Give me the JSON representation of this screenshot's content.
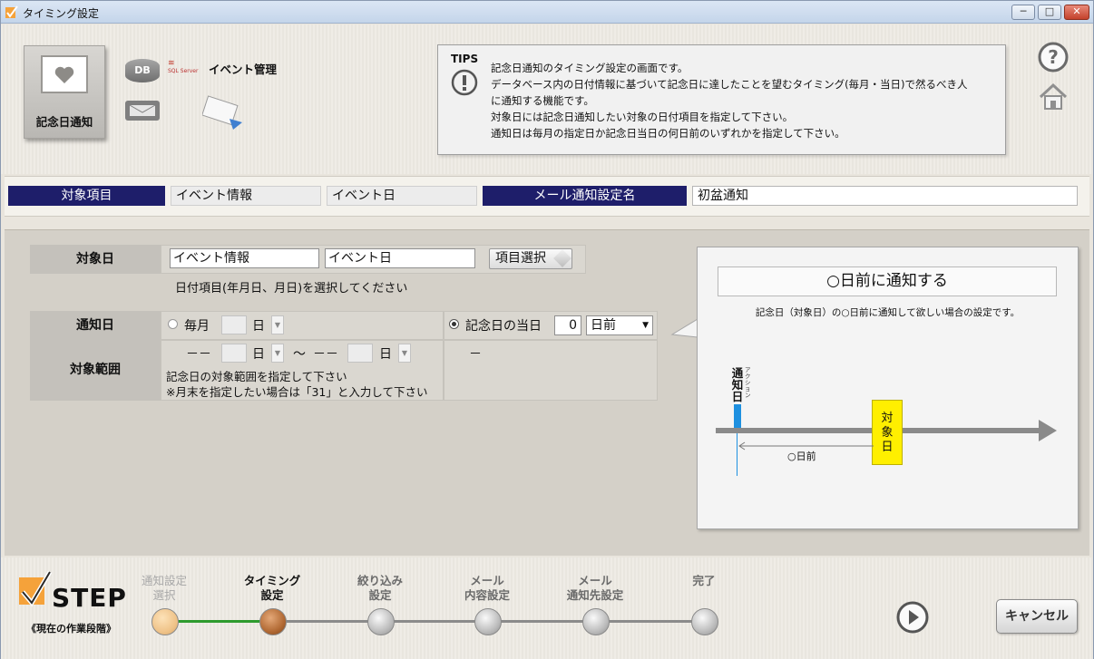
{
  "window": {
    "title": "タイミング設定",
    "minimize": "─",
    "maximize": "□",
    "close": "✕"
  },
  "header": {
    "feature_label": "記念日通知",
    "db_label": "DB",
    "sqlserver_label": "SQL Server",
    "event_mgmt_label": "イベント管理",
    "tips_title": "TIPS",
    "tips_lines": [
      "記念日通知のタイミング設定の画面です。",
      "データベース内の日付情報に基づいて記念日に達したことを望むタイミング(毎月・当日)で然るべき人",
      "に通知する機能です。",
      "対象日には記念日通知したい対象の日付項目を指定して下さい。",
      "通知日は毎月の指定日か記念日当日の何日前のいずれかを指定して下さい。"
    ]
  },
  "field_row": {
    "target_item_label": "対象項目",
    "target_item_value1": "イベント情報",
    "target_item_value2": "イベント日",
    "mail_setting_label": "メール通知設定名",
    "mail_setting_value": "初盆通知"
  },
  "form": {
    "target_date_label": "対象日",
    "target_date_input1": "イベント情報",
    "target_date_input2": "イベント日",
    "item_select_button": "項目選択",
    "target_date_hint": "日付項目(年月日、月日)を選択してください",
    "notify_date_label": "通知日",
    "monthly_label": "毎月",
    "day_unit": "日",
    "anniversary_label": "記念日の当日",
    "days_before_value": "0",
    "days_before_select": "日前",
    "range_label": "対象範囲",
    "range_dash": "－－",
    "range_tilde": "～",
    "range_hint1": "記念日の対象範囲を指定して下さい",
    "range_hint2": "※月末を指定したい場合は「31」と入力して下さい",
    "right_dash": "－"
  },
  "diagram": {
    "title": "○日前に通知する",
    "desc": "記念日（対象日）の○日前に通知して欲しい場合の設定です。",
    "notify_day": [
      "通",
      "知",
      "日"
    ],
    "action_label": "アクション",
    "target_day": [
      "対",
      "象",
      "日"
    ],
    "days_before": "○日前"
  },
  "footer": {
    "step_label": "STEP",
    "current_stage": "《現在の作業段階》",
    "steps": [
      {
        "line1": "通知設定",
        "line2": "選択"
      },
      {
        "line1": "タイミング",
        "line2": "設定"
      },
      {
        "line1": "絞り込み",
        "line2": "設定"
      },
      {
        "line1": "メール",
        "line2": "内容設定"
      },
      {
        "line1": "メール",
        "line2": "通知先設定"
      },
      {
        "line1": "",
        "line2": "完了"
      }
    ],
    "cancel_label": "キャンセル"
  },
  "colors": {
    "navy": "#1e1e6a",
    "accent_orange": "#f5a23a",
    "highlight_yellow": "#ffef00",
    "marker_blue": "#1e90e0",
    "progress_green": "#2e9b2e"
  }
}
